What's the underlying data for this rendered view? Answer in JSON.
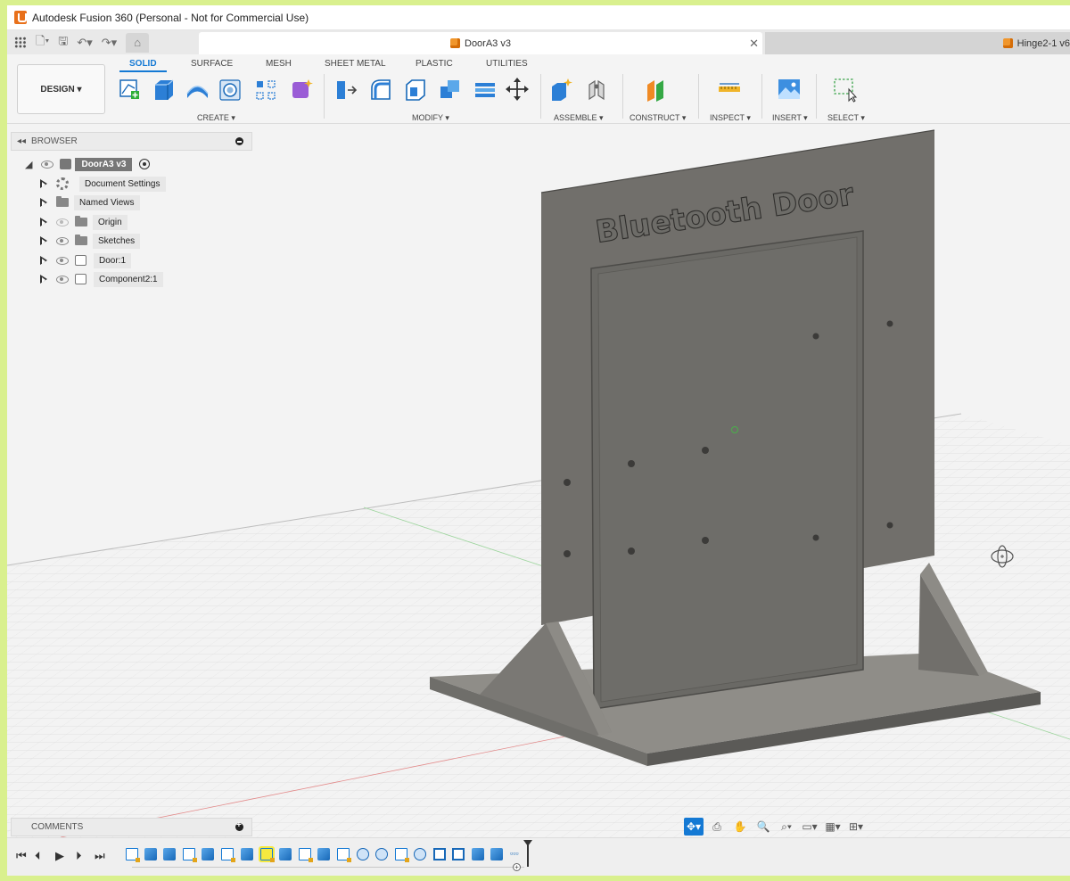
{
  "window": {
    "title": "Autodesk Fusion 360 (Personal - Not for Commercial Use)"
  },
  "tabs": [
    {
      "label": "DoorA3 v3",
      "active": true
    },
    {
      "label": "Hinge2-1 v6",
      "active": false
    }
  ],
  "ribbon": {
    "workspace": "DESIGN ▾",
    "tabs": [
      "SOLID",
      "SURFACE",
      "MESH",
      "SHEET METAL",
      "PLASTIC",
      "UTILITIES"
    ],
    "active_tab": "SOLID",
    "groups": [
      "CREATE ▾",
      "MODIFY ▾",
      "ASSEMBLE ▾",
      "CONSTRUCT ▾",
      "INSPECT ▾",
      "INSERT ▾",
      "SELECT ▾"
    ]
  },
  "browser": {
    "header": "BROWSER",
    "root": "DoorA3 v3",
    "items": [
      {
        "label": "Document Settings",
        "icon": "gear-icon"
      },
      {
        "label": "Named Views",
        "icon": "folder-icon"
      },
      {
        "label": "Origin",
        "icon": "folder-icon",
        "hidden": true
      },
      {
        "label": "Sketches",
        "icon": "folder-icon"
      },
      {
        "label": "Door:1",
        "icon": "component-icon"
      },
      {
        "label": "Component2:1",
        "icon": "component-icon"
      }
    ]
  },
  "model": {
    "engraved_text": "Bluetooth Door"
  },
  "comments": {
    "label": "COMMENTS"
  },
  "colors": {
    "accent": "#1479d4",
    "model": "#6f6e6a",
    "background": "#d9f08e"
  }
}
